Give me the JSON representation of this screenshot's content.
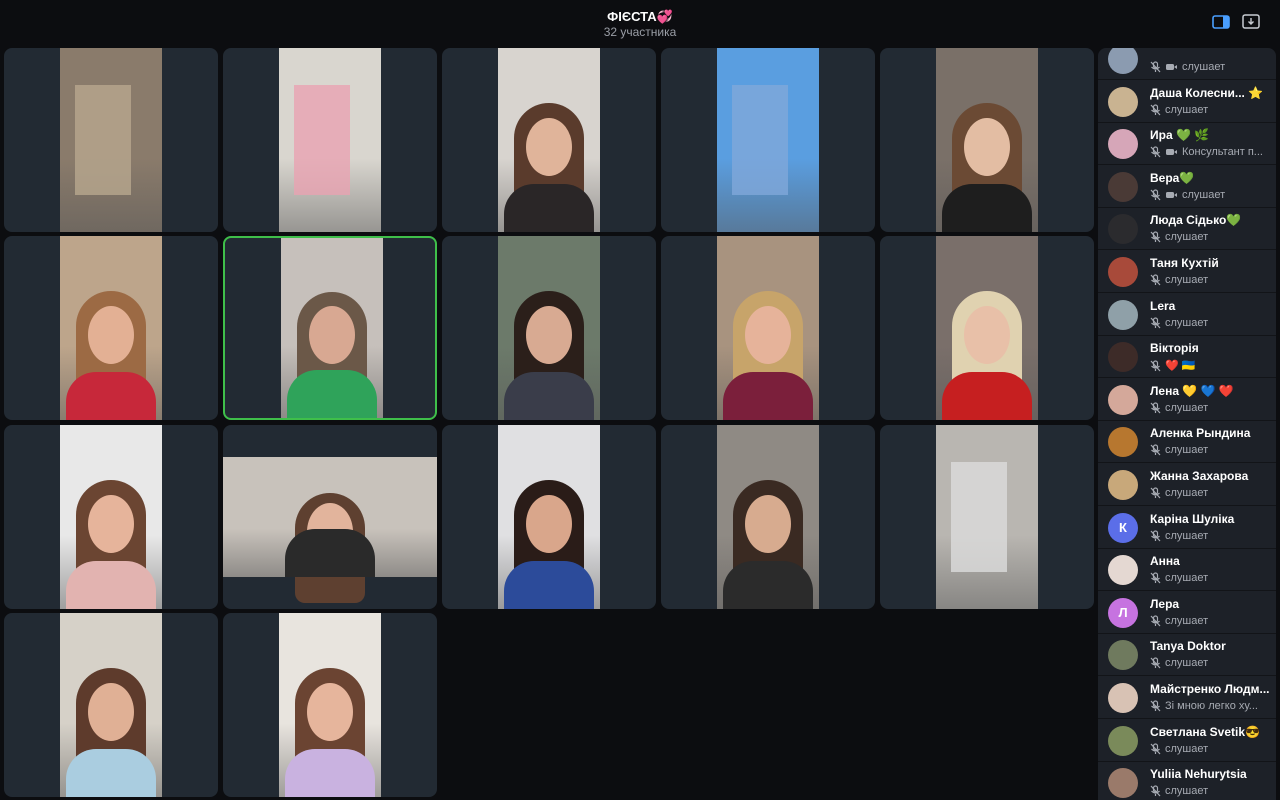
{
  "header": {
    "title": "ФІЄСТА💞",
    "subtitle": "32 участника"
  },
  "colors": {
    "background": "#0c0d10",
    "tile": "#222a33",
    "sidebar": "#1d2128",
    "active_border": "#3fbf4a",
    "accent": "#4a9fff"
  },
  "icons": {
    "layout": "sidebar-layout-icon",
    "pip": "picture-in-picture-icon",
    "mic_muted": "mic-off-icon",
    "camera": "camera-icon"
  },
  "participants": [
    {
      "name": "",
      "status": "слушает",
      "camera": true,
      "avatar_color": "#8b9bb0",
      "initial": ""
    },
    {
      "name": "Даша Колесни... ⭐",
      "status": "слушает",
      "camera": false,
      "avatar_color": "#c9b391",
      "initial": ""
    },
    {
      "name": "Ира 💚 🌿",
      "status": "Консультант п...",
      "camera": true,
      "avatar_color": "#d6a6b8",
      "initial": ""
    },
    {
      "name": "Вера💚",
      "status": "слушает",
      "camera": true,
      "avatar_color": "#4a3a36",
      "initial": ""
    },
    {
      "name": "Люда Сідько💚",
      "status": "слушает",
      "camera": false,
      "avatar_color": "#2b2b2e",
      "initial": ""
    },
    {
      "name": "Таня Кухтій",
      "status": "слушает",
      "camera": false,
      "avatar_color": "#a84a3a",
      "initial": ""
    },
    {
      "name": "Lera",
      "status": "слушает",
      "camera": false,
      "avatar_color": "#8fa0a8",
      "initial": ""
    },
    {
      "name": "Вікторія",
      "status": "❤️ 🇺🇦",
      "camera": false,
      "avatar_color": "#3d2b28",
      "initial": ""
    },
    {
      "name": "Лена 💛 💙 ❤️",
      "status": "слушает",
      "camera": false,
      "avatar_color": "#d4a89a",
      "initial": ""
    },
    {
      "name": "Аленка Рындина",
      "status": "слушает",
      "camera": false,
      "avatar_color": "#b7772f",
      "initial": ""
    },
    {
      "name": "Жанна Захарова",
      "status": "слушает",
      "camera": false,
      "avatar_color": "#c8a87a",
      "initial": ""
    },
    {
      "name": "Каріна Шуліка",
      "status": "слушает",
      "camera": false,
      "avatar_color": "#5b6ee8",
      "initial": "К"
    },
    {
      "name": "Анна",
      "status": "слушает",
      "camera": false,
      "avatar_color": "#e4d8d2",
      "initial": ""
    },
    {
      "name": "Лера",
      "status": "слушает",
      "camera": false,
      "avatar_color": "#c673e0",
      "initial": "Л"
    },
    {
      "name": "Tanya Doktor",
      "status": "слушает",
      "camera": false,
      "avatar_color": "#6f7a5e",
      "initial": ""
    },
    {
      "name": "Майстренко Людм...",
      "status": "Зі мною легко ху...",
      "camera": false,
      "avatar_color": "#d8c2b4",
      "initial": ""
    },
    {
      "name": "Светлана Svetik😎",
      "status": "слушает",
      "camera": false,
      "avatar_color": "#7a8a5a",
      "initial": ""
    },
    {
      "name": "Yuliia Nehurytsia",
      "status": "слушает",
      "camera": false,
      "avatar_color": "#9a7a6a",
      "initial": ""
    }
  ],
  "tiles": [
    {
      "id": "video-tile-1",
      "shirt": "#b8a88f",
      "hair": "#6b5640",
      "face": "#c9b8a4",
      "bg": "#8a7b6b",
      "person": false,
      "wide": false
    },
    {
      "id": "video-tile-2",
      "shirt": "#e8a3b1",
      "hair": "#777",
      "face": "#e6e3dd",
      "bg": "#d9d6cf",
      "person": false,
      "wide": false
    },
    {
      "id": "video-tile-3",
      "shirt": "#2a2627",
      "hair": "#5a3b2c",
      "face": "#e0b49a",
      "bg": "#d8d4cf",
      "person": true,
      "wide": false
    },
    {
      "id": "video-tile-4",
      "shirt": "#7fa8d9",
      "hair": "#3b5e2e",
      "face": "#d9a98c",
      "bg": "#5a9ee0",
      "person": false,
      "wide": false
    },
    {
      "id": "video-tile-5",
      "shirt": "#1e1e1e",
      "hair": "#6b4a34",
      "face": "#e3bda3",
      "bg": "#7a7068",
      "person": true,
      "wide": false
    },
    {
      "id": "video-tile-6",
      "shirt": "#c7283a",
      "hair": "#9c6a44",
      "face": "#e3b094",
      "bg": "#bda58b",
      "person": true,
      "wide": false
    },
    {
      "id": "video-tile-7",
      "shirt": "#2fa35a",
      "hair": "#6b5848",
      "face": "#d8a892",
      "bg": "#c6c0bb",
      "person": true,
      "wide": false
    },
    {
      "id": "video-tile-8",
      "shirt": "#3a3d4a",
      "hair": "#2b1f1a",
      "face": "#d8aa92",
      "bg": "#6c7a6a",
      "person": true,
      "wide": false
    },
    {
      "id": "video-tile-9",
      "shirt": "#7b1f3b",
      "hair": "#c7a46a",
      "face": "#e6b39a",
      "bg": "#a8937f",
      "person": true,
      "wide": false
    },
    {
      "id": "video-tile-10",
      "shirt": "#c61f20",
      "hair": "#e0d2b0",
      "face": "#e8c0a8",
      "bg": "#7a6f6a",
      "person": true,
      "wide": false
    },
    {
      "id": "video-tile-11",
      "shirt": "#e2b3b0",
      "hair": "#6b4532",
      "face": "#e6b49b",
      "bg": "#e8e8e8",
      "person": true,
      "wide": false
    },
    {
      "id": "video-tile-12",
      "shirt": "#2a2a2a",
      "hair": "#5e4030",
      "face": "#e2b49c",
      "bg": "#c8c2bb",
      "person": true,
      "wide": true
    },
    {
      "id": "video-tile-13",
      "shirt": "#2c4b9a",
      "hair": "#2a1c18",
      "face": "#d9a68b",
      "bg": "#e0e0e2",
      "person": true,
      "wide": false
    },
    {
      "id": "video-tile-14",
      "shirt": "#2b2b2b",
      "hair": "#3a2a22",
      "face": "#d7ab8f",
      "bg": "#8f8a84",
      "person": true,
      "wide": false
    },
    {
      "id": "video-tile-15",
      "shirt": "#dcdcdc",
      "hair": "#888",
      "face": "#d0d0d0",
      "bg": "#b9b6b1",
      "person": false,
      "wide": false
    },
    {
      "id": "video-tile-16",
      "shirt": "#aacde0",
      "hair": "#5e3b2c",
      "face": "#e0b095",
      "bg": "#d6d1c8",
      "person": true,
      "wide": false
    },
    {
      "id": "video-tile-17",
      "shirt": "#c9b2e0",
      "hair": "#6b4432",
      "face": "#e6b59c",
      "bg": "#e8e4de",
      "person": true,
      "wide": false
    }
  ]
}
